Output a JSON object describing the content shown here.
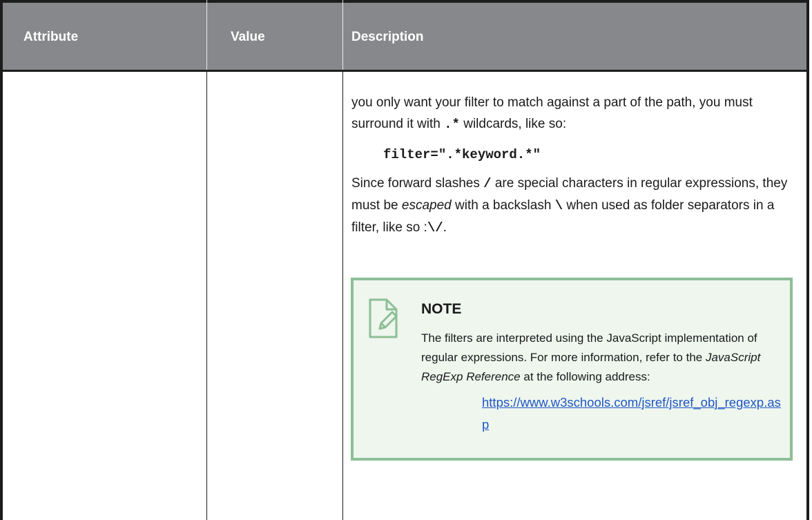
{
  "table": {
    "headers": [
      "Attribute",
      "Value",
      "Description"
    ]
  },
  "description": {
    "para1_a": "you only want your filter to match against a part of the path, you must surround it with ",
    "para1_code": ".*",
    "para1_b": " wildcards, like so:",
    "code_example": "filter=\".*keyword.*\"",
    "para2_a": "Since forward slashes ",
    "para2_code1": "/",
    "para2_b": " are special characters in regular expressions, they must be ",
    "para2_em": "escaped",
    "para2_c": " with a backslash ",
    "para2_code2": "\\",
    "para2_d": " when used as folder separators in a filter, like so :",
    "para2_code3": "\\/",
    "para2_e": "."
  },
  "note": {
    "icon": "note-pencil-icon",
    "title": "NOTE",
    "text_a": "The filters are interpreted using the JavaScript implementation of regular expressions. For more information, refer to the ",
    "text_em": "JavaScript RegExp Reference",
    "text_b": " at the following address:",
    "link": "https://www.w3schools.com/jsref/jsref_obj_regexp.asp"
  },
  "colors": {
    "header_bg": "#87888b",
    "note_bg": "#eef6ee",
    "note_border": "#8dbf96",
    "link": "#1f56c4"
  }
}
